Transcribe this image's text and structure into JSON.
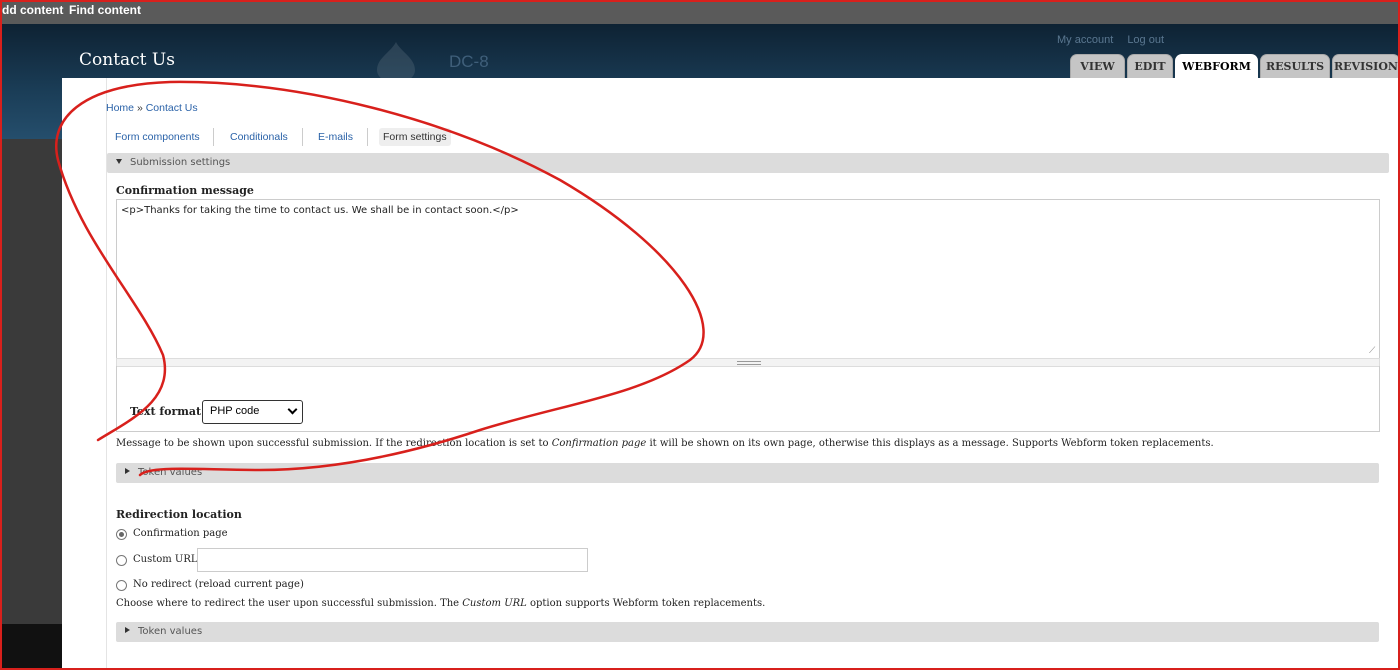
{
  "admin_bar": {
    "items": [
      "dd content",
      "Find content"
    ]
  },
  "header": {
    "site_title": "Contact Us",
    "slogan": "DC-8",
    "secondary_menu": [
      "My account",
      "Log out"
    ],
    "tabs": [
      {
        "label": "VIEW",
        "active": false
      },
      {
        "label": "EDIT",
        "active": false
      },
      {
        "label": "WEBFORM",
        "active": true
      },
      {
        "label": "RESULTS",
        "active": false
      },
      {
        "label": "REVISION",
        "active": false
      }
    ]
  },
  "breadcrumb": {
    "home": "Home",
    "separator": "»",
    "current": "Contact Us"
  },
  "subtabs": [
    {
      "label": "Form components",
      "active": false
    },
    {
      "label": "Conditionals",
      "active": false
    },
    {
      "label": "E-mails",
      "active": false
    },
    {
      "label": "Form settings",
      "active": true
    }
  ],
  "submission_settings": {
    "legend": "Submission settings",
    "confirmation": {
      "label": "Confirmation message",
      "value": "<p>Thanks for taking the time to contact us. We shall be in contact soon.</p>",
      "text_format_label": "Text format",
      "text_format_value": "PHP code",
      "description_parts": [
        "Message to be shown upon successful submission. If the redirection location is set to ",
        "Confirmation page",
        " it will be shown on its own page, otherwise this displays as a message. Supports Webform token replacements."
      ],
      "token_legend": "Token values"
    },
    "redirection": {
      "label": "Redirection location",
      "options": [
        {
          "label": "Confirmation page",
          "checked": true
        },
        {
          "label": "Custom URL:",
          "checked": false
        },
        {
          "label": "No redirect (reload current page)",
          "checked": false
        }
      ],
      "custom_url_value": "",
      "description_parts": [
        "Choose where to redirect the user upon successful submission. The ",
        "Custom URL",
        " option supports Webform token replacements."
      ],
      "token_legend": "Token values"
    }
  },
  "colors": {
    "annotation": "#d8201c",
    "link": "#2a62a8",
    "header": "#1b3e58"
  },
  "icons": {
    "section_toggle": "triangle-down-icon",
    "token_toggle": "triangle-right-icon",
    "logo": "drupal-drop-icon"
  }
}
